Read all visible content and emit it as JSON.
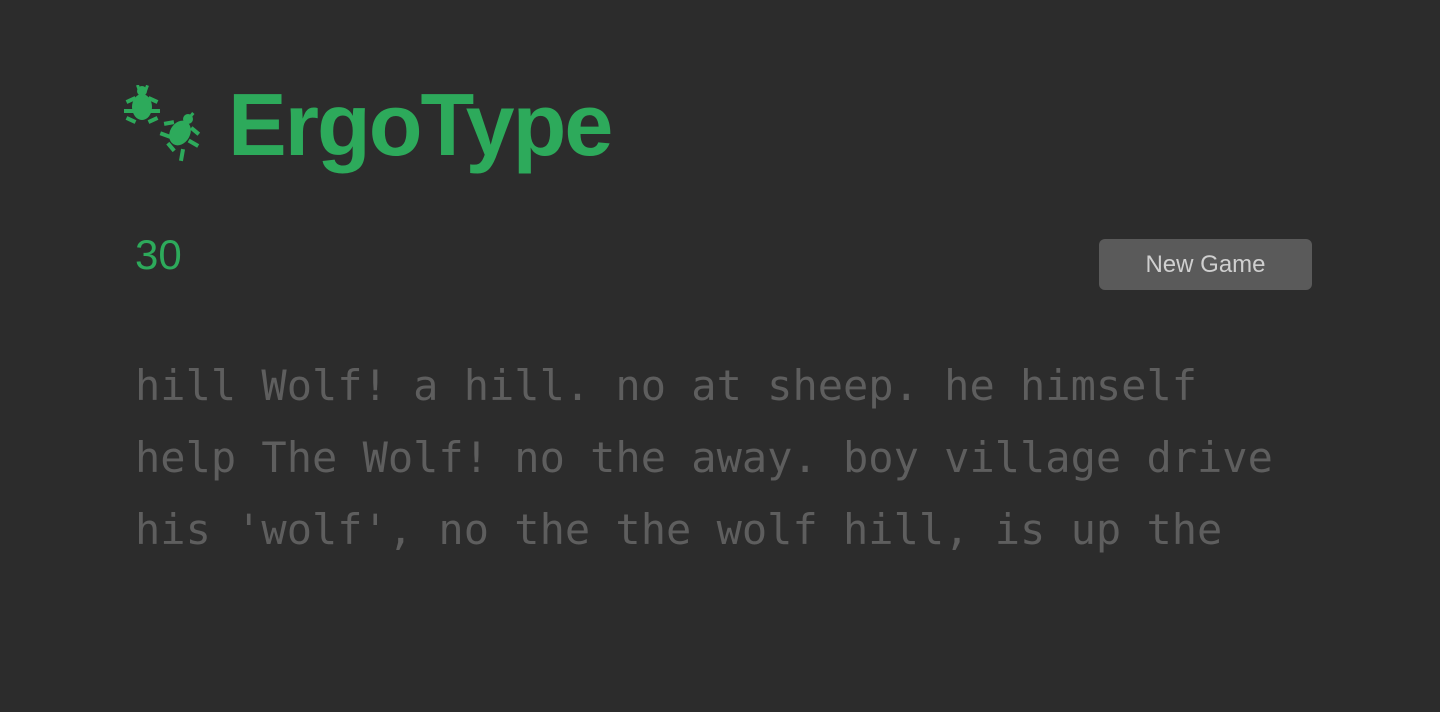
{
  "app": {
    "title": "ErgoType",
    "logo_icon": "ant-bugs-icon"
  },
  "game": {
    "timer": "30",
    "new_game_label": "New Game",
    "lines": [
      "hill Wolf! a hill. no at sheep. he himself",
      "help The Wolf! no the away. boy village drive",
      "his 'wolf', no the the wolf hill, is up the"
    ]
  },
  "colors": {
    "background": "#2c2c2c",
    "accent": "#2daa5b",
    "text_pending": "#5e5e5e",
    "button_bg": "#5a5a5a",
    "button_text": "#cfcfcf"
  }
}
